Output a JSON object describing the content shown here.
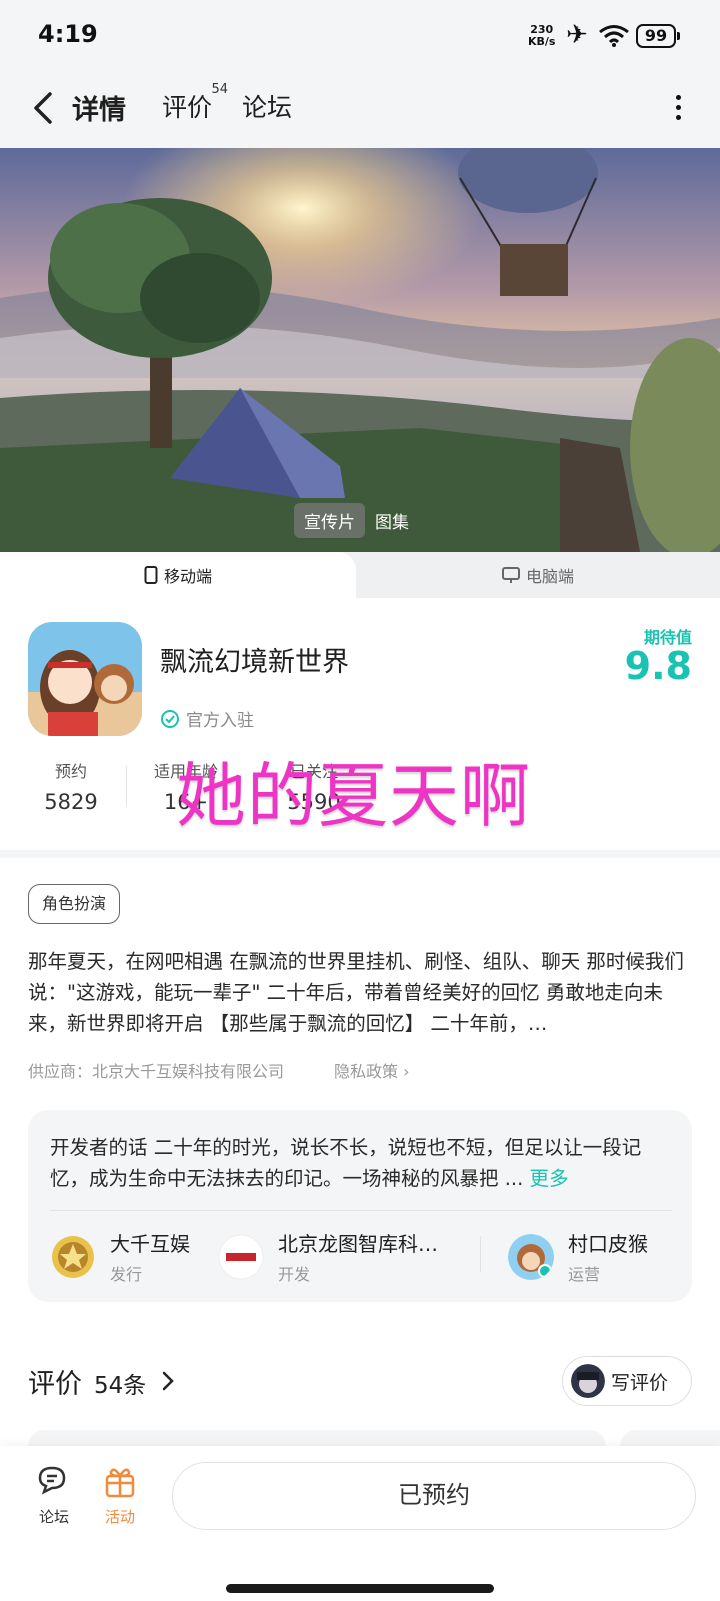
{
  "status": {
    "time": "4:19",
    "speed_value": "230",
    "speed_unit": "KB/s",
    "battery": "99"
  },
  "nav": {
    "tabs": [
      {
        "label": "详情",
        "active": true
      },
      {
        "label": "评价",
        "badge": "54"
      },
      {
        "label": "论坛"
      }
    ]
  },
  "media": {
    "tabs": [
      "宣传片",
      "图集"
    ]
  },
  "platform": {
    "mobile": "移动端",
    "pc": "电脑端"
  },
  "game": {
    "name": "飘流幻境新世界",
    "verified": "官方入驻",
    "expect_label": "期待值",
    "expect_value": "9.8",
    "stats": [
      {
        "label": "预约",
        "value": "5829"
      },
      {
        "label": "适用年龄",
        "value": "16+"
      },
      {
        "label": "已关注",
        "value": "5590"
      }
    ],
    "overlay": "她的夏天啊",
    "genre": "角色扮演",
    "description": "那年夏天，在网吧相遇 在飘流的世界里挂机、刷怪、组队、聊天 那时候我们说：\"这游戏，能玩一辈子\" 二十年后，带着曾经美好的回忆 勇敢地走向未来，新世界即将开启 【那些属于飘流的回忆】 二十年前，…",
    "supplier": "供应商：北京大千互娱科技有限公司",
    "privacy": "隐私政策"
  },
  "developer": {
    "text": "开发者的话  二十年的时光，说长不长，说短也不短，但足以让一段记忆，成为生命中无法抹去的印记。一场神秘的风暴把 ... ",
    "more": "更多",
    "orgs": [
      {
        "name": "大千互娱",
        "role": "发行"
      },
      {
        "name": "北京龙图智库科…",
        "role": "开发"
      },
      {
        "name": "村口皮猴",
        "role": "运营"
      }
    ]
  },
  "reviews": {
    "title": "评价",
    "count": "54条",
    "write": "写评价"
  },
  "bottom": {
    "forum": "论坛",
    "activity": "活动",
    "reserve": "已预约"
  },
  "colors": {
    "accent": "#19c3b1",
    "overlay": "#ee34c4",
    "activity": "#f08a3c"
  }
}
